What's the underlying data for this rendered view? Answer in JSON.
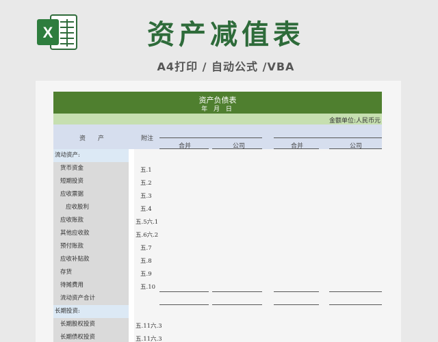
{
  "banner": {
    "logo_letter": "X",
    "title": "资产减值表",
    "subtitle": "A4打印 / 自动公式 /VBA"
  },
  "sheet": {
    "title": "资产负债表",
    "date_line": "年 月 日",
    "unit": "金额单位:人民币元",
    "header": {
      "asset": "资　　产",
      "note": "附注",
      "merged_1": "合并",
      "company_1": "公司",
      "merged_2": "合并",
      "company_2": "公司"
    },
    "rows": [
      {
        "label": "流动资产:",
        "type": "sec",
        "note": ""
      },
      {
        "label": "货币资金",
        "type": "item",
        "note": "五.1"
      },
      {
        "label": "短期投资",
        "type": "item",
        "note": "五.2"
      },
      {
        "label": "应收票据",
        "type": "item",
        "note": "五.3"
      },
      {
        "label": "应收股利",
        "type": "item2",
        "note": "五.4"
      },
      {
        "label": "应收账款",
        "type": "item",
        "note": "五.5六.1"
      },
      {
        "label": "其他应收款",
        "type": "item",
        "note": "五.6六.2"
      },
      {
        "label": "预付账款",
        "type": "item",
        "note": "五.7"
      },
      {
        "label": "应收补贴款",
        "type": "item",
        "note": "五.8"
      },
      {
        "label": "存货",
        "type": "item",
        "note": "五.9"
      },
      {
        "label": "待摊费用",
        "type": "item",
        "note": "五.10"
      },
      {
        "label": "流动资产合计",
        "type": "item",
        "note": ""
      },
      {
        "label": "长期投资:",
        "type": "sec",
        "note": ""
      },
      {
        "label": "长期股权投资",
        "type": "item",
        "note": "五.11六.3"
      },
      {
        "label": "长期债权投资",
        "type": "item",
        "note": "五.11六.3"
      }
    ]
  },
  "colors": {
    "brand_green": "#2e6b3a",
    "title_band": "#4f7f2f",
    "unit_band": "#c6dfb0",
    "header_band": "#d6deee"
  }
}
